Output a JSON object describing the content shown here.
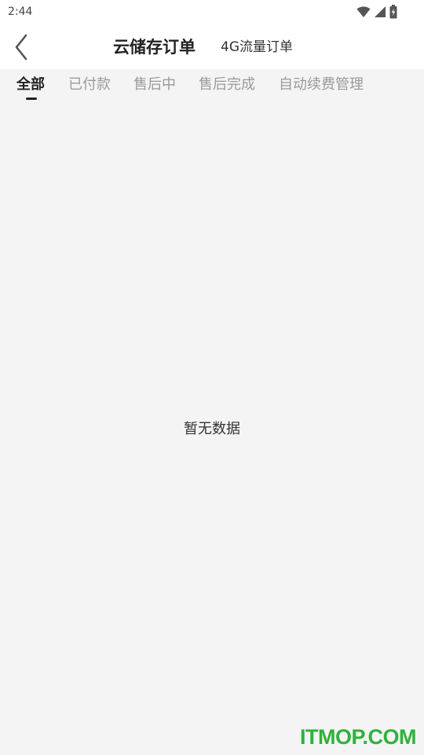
{
  "status_bar": {
    "time": "2:44",
    "icons": [
      "wifi-icon",
      "cellular-signal-icon",
      "battery-charging-icon"
    ]
  },
  "header": {
    "back_icon": "chevron-left-icon",
    "tabs": [
      {
        "label": "云储存订单",
        "active": true
      },
      {
        "label": "4G流量订单",
        "active": false
      }
    ]
  },
  "filter_tabs": [
    {
      "label": "全部",
      "active": true
    },
    {
      "label": "已付款",
      "active": false
    },
    {
      "label": "售后中",
      "active": false
    },
    {
      "label": "售后完成",
      "active": false
    },
    {
      "label": "自动续费管理",
      "active": false
    }
  ],
  "empty_state": {
    "text": "暂无数据"
  },
  "watermark": {
    "text": "ITMOP.COM"
  },
  "colors": {
    "background": "#f4f4f4",
    "header_background": "#ffffff",
    "active_text": "#222222",
    "inactive_text": "#9a9a9a",
    "watermark": "#2fb13c"
  }
}
